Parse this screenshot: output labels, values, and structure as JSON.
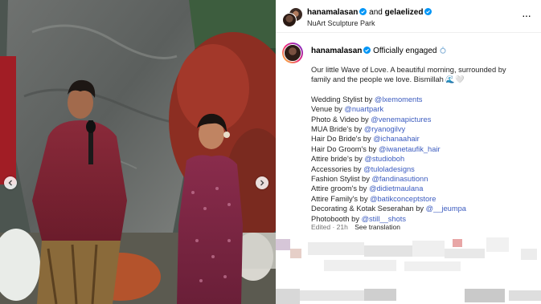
{
  "post": {
    "author1": "hanamalasan",
    "joiner": "and",
    "author2": "gelaelized",
    "location": "NuArt Sculpture Park",
    "more": "···"
  },
  "caption": {
    "username": "hanamalasan",
    "status": "Officially engaged",
    "text1": "Our little Wave of Love. A beautiful morning, surrounded by",
    "text2": "family and the people we love. Bismillah 🌊🤍",
    "credits": [
      {
        "role": "Wedding Stylist by",
        "handle": "@lxemoments"
      },
      {
        "role": "Venue by",
        "handle": "@nuartpark"
      },
      {
        "role": "Photo & Video by",
        "handle": "@venemapictures"
      },
      {
        "role": "MUA Bride's by",
        "handle": "@ryanogilvy"
      },
      {
        "role": "Hair Do Bride's by",
        "handle": "@ichanaahair"
      },
      {
        "role": "Hair Do Groom's by",
        "handle": "@iwanetaufik_hair"
      },
      {
        "role": "Attire bride's by",
        "handle": "@studioboh"
      },
      {
        "role": "Accessories by",
        "handle": "@tuloladesigns"
      },
      {
        "role": "Fashion Stylist by",
        "handle": "@fandinasutionn"
      },
      {
        "role": "Attire groom's by",
        "handle": "@didietmaulana"
      },
      {
        "role": "Attire Family's by",
        "handle": "@batikconceptstore"
      },
      {
        "role": "Decorating & Kotak Seserahan by",
        "handle": "@__jeumpa"
      },
      {
        "role": "Photobooth by",
        "handle": "@still__shots"
      }
    ],
    "edited": "Edited · 21h",
    "see_translation": "See translation"
  },
  "colors": {
    "link": "#3b5bbf",
    "verified": "#0095f6"
  }
}
